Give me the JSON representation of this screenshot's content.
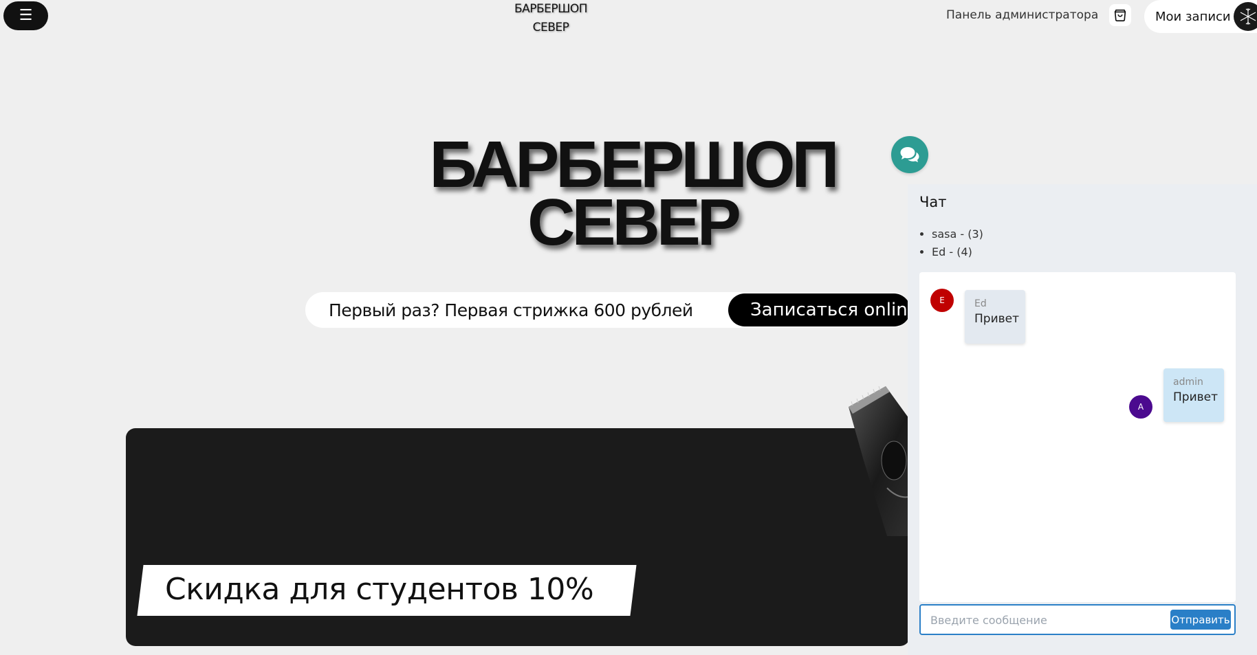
{
  "header": {
    "menu_icon": "☰",
    "logo_line1": "БАРБЕРШОП",
    "logo_line2": "СЕВЕР",
    "admin_panel": "Панель администратора",
    "my_records": "Мои записи"
  },
  "hero": {
    "title_line1": "БАРБЕРШОП",
    "title_line2": "СЕВЕР",
    "promo_text": "Первый раз? Первая стрижка 600 рублей",
    "book_button": "Записаться online"
  },
  "banner": {
    "discount_text": "Скидка для студентов 10%"
  },
  "chat": {
    "title": "Чат",
    "conversations": [
      "sasa - (3)",
      "Ed - (4)"
    ],
    "messages": [
      {
        "avatar_letter": "E",
        "name": "Ed",
        "text": "Привет",
        "avatar_color": "#c00000"
      },
      {
        "avatar_letter": "A",
        "name": "admin",
        "text": "Привет",
        "avatar_color": "#4b0a8f"
      }
    ],
    "input_placeholder": "Введите сообщение",
    "send_button": "Отправить"
  },
  "colors": {
    "background": "#efefef",
    "chat_accent": "#2d9c93",
    "send_blue": "#2a7fc7",
    "banner_dark": "#1b1b1b"
  }
}
